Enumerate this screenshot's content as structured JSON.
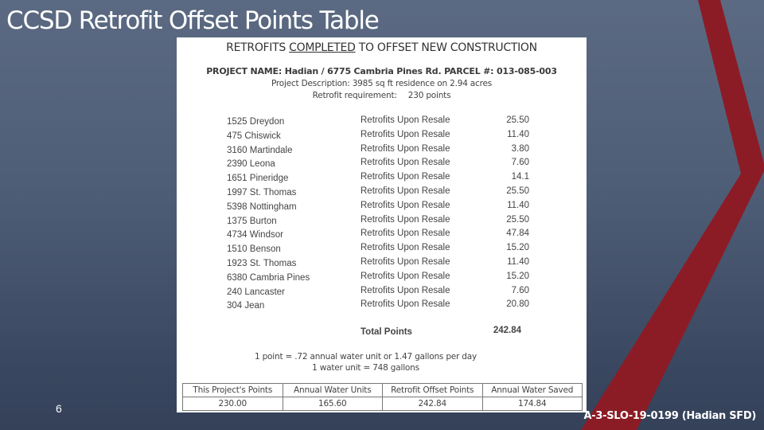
{
  "slide": {
    "title": "CCSD Retrofit Offset Points Table",
    "number": "6",
    "footer_code": "A-3-SLO-19-0199 (Hadian SFD)",
    "colors": {
      "background_top": "#5b6a82",
      "background_bottom": "#344159",
      "accent_red": "#8b1c26"
    }
  },
  "document": {
    "heading_before": "RETROFITS ",
    "heading_underlined": "COMPLETED",
    "heading_after": " TO OFFSET NEW CONSTRUCTION",
    "project_name": "PROJECT NAME: Hadian / 6775 Cambria Pines Rd. PARCEL #: 013-085-003",
    "project_description": "Project Description: 3985 sq ft residence on 2.94 acres",
    "retrofit_requirement_label": "Retrofit requirement:",
    "retrofit_requirement_value": "230 points",
    "retrofits": [
      {
        "address": "1525 Dreydon",
        "type": "Retrofits Upon Resale",
        "points": "25.50"
      },
      {
        "address": "475 Chiswick",
        "type": "Retrofits Upon Resale",
        "points": "11.40"
      },
      {
        "address": "3160 Martindale",
        "type": "Retrofits Upon Resale",
        "points": "3.80"
      },
      {
        "address": "2390 Leona",
        "type": "Retrofits Upon Resale",
        "points": "7.60"
      },
      {
        "address": "1651 Pineridge",
        "type": "Retrofits Upon Resale",
        "points": "14.1"
      },
      {
        "address": "1997 St. Thomas",
        "type": "Retrofits Upon Resale",
        "points": "25.50"
      },
      {
        "address": "5398 Nottingham",
        "type": "Retrofits Upon Resale",
        "points": "11.40"
      },
      {
        "address": "1375 Burton",
        "type": "Retrofits Upon Resale",
        "points": "25.50"
      },
      {
        "address": "4734 Windsor",
        "type": "Retrofits Upon Resale",
        "points": "47.84"
      },
      {
        "address": "1510 Benson",
        "type": "Retrofits Upon Resale",
        "points": "15.20"
      },
      {
        "address": "1923 St. Thomas",
        "type": "Retrofits Upon Resale",
        "points": "11.40"
      },
      {
        "address": "6380 Cambria Pines",
        "type": "Retrofits Upon Resale",
        "points": "15.20"
      },
      {
        "address": "240 Lancaster",
        "type": "Retrofits Upon Resale",
        "points": "7.60"
      },
      {
        "address": "304 Jean",
        "type": "Retrofits Upon Resale",
        "points": "20.80"
      }
    ],
    "total_label": "Total Points",
    "total_value": "242.84",
    "note_1": "1 point = .72 annual water unit or 1.47 gallons per day",
    "note_2": "1 water unit = 748 gallons",
    "summary_table": {
      "headers": [
        "This Project's Points",
        "Annual Water Units",
        "Retrofit Offset Points",
        "Annual Water Saved"
      ],
      "values": [
        "230.00",
        "165.60",
        "242.84",
        "174.84"
      ]
    }
  }
}
